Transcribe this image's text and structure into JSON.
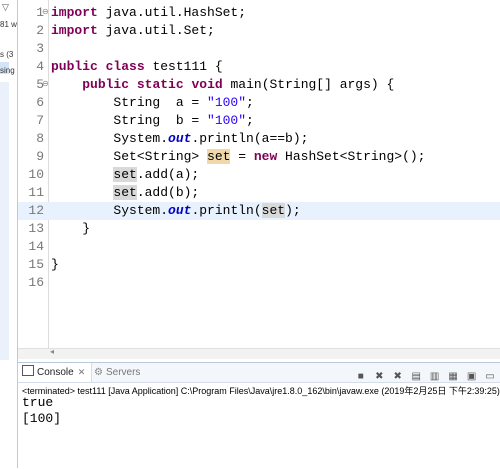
{
  "left_panel": {
    "fragments": [
      "81 w",
      "s (3",
      "sing"
    ]
  },
  "editor": {
    "lines": [
      {
        "num": "1",
        "fold": "⊖",
        "segments": [
          {
            "t": "import",
            "k": "kw"
          },
          {
            "t": " java.util.HashSet;",
            "k": ""
          }
        ]
      },
      {
        "num": "2",
        "fold": "",
        "segments": [
          {
            "t": "import",
            "k": "kw"
          },
          {
            "t": " java.util.Set;",
            "k": ""
          }
        ]
      },
      {
        "num": "3",
        "fold": "",
        "segments": []
      },
      {
        "num": "4",
        "fold": "",
        "segments": [
          {
            "t": "public",
            "k": "kw"
          },
          {
            "t": " ",
            "k": ""
          },
          {
            "t": "class",
            "k": "kw"
          },
          {
            "t": " test111 {",
            "k": ""
          }
        ]
      },
      {
        "num": "5",
        "fold": "⊖",
        "segments": [
          {
            "t": "    ",
            "k": ""
          },
          {
            "t": "public",
            "k": "kw"
          },
          {
            "t": " ",
            "k": ""
          },
          {
            "t": "static",
            "k": "kw"
          },
          {
            "t": " ",
            "k": ""
          },
          {
            "t": "void",
            "k": "kw"
          },
          {
            "t": " main(String[] args) {",
            "k": ""
          }
        ]
      },
      {
        "num": "6",
        "fold": "",
        "segments": [
          {
            "t": "        String  a = ",
            "k": ""
          },
          {
            "t": "\"100\"",
            "k": "str"
          },
          {
            "t": ";",
            "k": ""
          }
        ]
      },
      {
        "num": "7",
        "fold": "",
        "segments": [
          {
            "t": "        String  b = ",
            "k": ""
          },
          {
            "t": "\"100\"",
            "k": "str"
          },
          {
            "t": ";",
            "k": ""
          }
        ]
      },
      {
        "num": "8",
        "fold": "",
        "segments": [
          {
            "t": "        System.",
            "k": ""
          },
          {
            "t": "out",
            "k": "fld"
          },
          {
            "t": ".println(a==b);",
            "k": ""
          }
        ]
      },
      {
        "num": "9",
        "fold": "",
        "segments": [
          {
            "t": "        Set<String> ",
            "k": ""
          },
          {
            "t": "set",
            "k": "occ"
          },
          {
            "t": " = ",
            "k": ""
          },
          {
            "t": "new",
            "k": "kw"
          },
          {
            "t": " HashSet<String>();",
            "k": ""
          }
        ]
      },
      {
        "num": "10",
        "fold": "",
        "segments": [
          {
            "t": "        ",
            "k": ""
          },
          {
            "t": "set",
            "k": "occ2"
          },
          {
            "t": ".add(a);",
            "k": ""
          }
        ]
      },
      {
        "num": "11",
        "fold": "",
        "segments": [
          {
            "t": "        ",
            "k": ""
          },
          {
            "t": "set",
            "k": "occ2"
          },
          {
            "t": ".add(b);",
            "k": ""
          }
        ]
      },
      {
        "num": "12",
        "fold": "",
        "current": true,
        "segments": [
          {
            "t": "        System.",
            "k": ""
          },
          {
            "t": "out",
            "k": "fld"
          },
          {
            "t": ".println(",
            "k": ""
          },
          {
            "t": "set",
            "k": "occ2"
          },
          {
            "t": ");",
            "k": ""
          }
        ]
      },
      {
        "num": "13",
        "fold": "",
        "segments": [
          {
            "t": "    }",
            "k": ""
          }
        ]
      },
      {
        "num": "14",
        "fold": "",
        "segments": []
      },
      {
        "num": "15",
        "fold": "",
        "segments": [
          {
            "t": "}",
            "k": ""
          }
        ]
      },
      {
        "num": "16",
        "fold": "",
        "segments": []
      }
    ]
  },
  "console": {
    "tab_console": "Console",
    "tab_servers": "Servers",
    "terminated": "<terminated> test111 [Java Application] C:\\Program Files\\Java\\jre1.8.0_162\\bin\\javaw.exe (2019年2月25日 下午2:39:25)",
    "output": [
      "true",
      "[100]"
    ]
  }
}
